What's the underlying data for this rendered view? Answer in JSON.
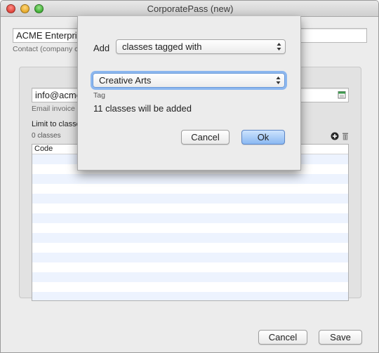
{
  "window": {
    "title": "CorporatePass (new)"
  },
  "form": {
    "contact_value": "ACME Enterpris",
    "contact_hint": "Contact (company c",
    "email_value": "info@acme",
    "email_hint": "Email invoice c",
    "limit_label": "Limit to classe",
    "classes_count": "0 classes",
    "table_header": "Code"
  },
  "footer": {
    "cancel_label": "Cancel",
    "save_label": "Save"
  },
  "sheet": {
    "add_label": "Add",
    "mode_value": "classes tagged with",
    "tag_value": "Creative Arts",
    "tag_caption": "Tag",
    "result_text": "11 classes will be added",
    "cancel_label": "Cancel",
    "ok_label": "Ok"
  },
  "icons": {
    "add": "plus-circle-icon",
    "delete": "trash-icon",
    "calendar": "calendar-icon"
  },
  "colors": {
    "accent": "#8cb7ef",
    "default_button": "#8ab8f2",
    "alt_row": "#edf3fe"
  }
}
